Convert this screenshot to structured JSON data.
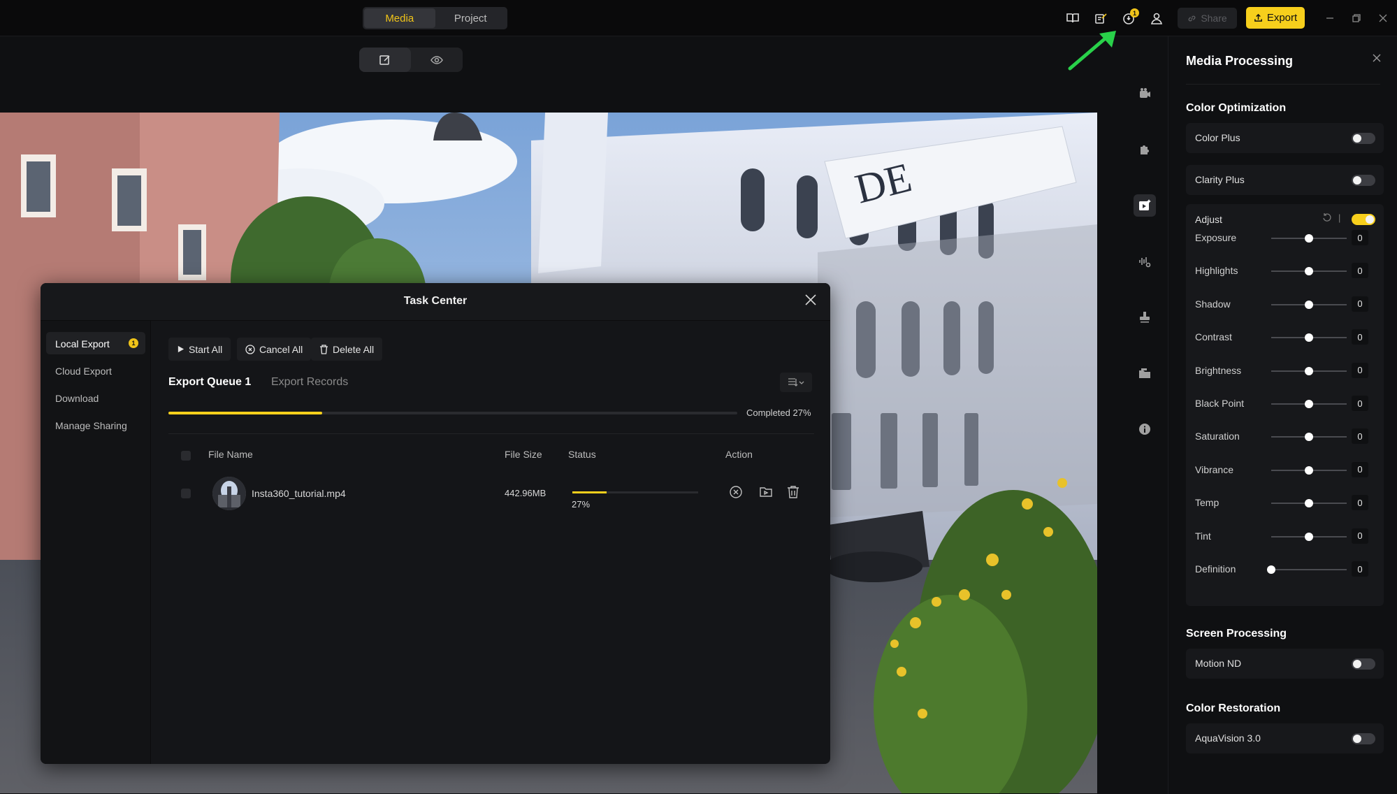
{
  "topbar": {
    "tabs": [
      {
        "label": "Media",
        "active": true
      },
      {
        "label": "Project",
        "active": false
      }
    ],
    "icons": [
      "book-icon",
      "edit-notes-icon",
      "task-center-icon",
      "user-icon"
    ],
    "task_badge": "1",
    "share_label": "Share",
    "export_label": "Export",
    "window_controls": [
      "minimize-icon",
      "restore-icon",
      "close-icon"
    ]
  },
  "view_toggle": [
    "edit-icon",
    "preview-eye-icon"
  ],
  "task_center": {
    "title": "Task Center",
    "sidebar": [
      {
        "label": "Local Export",
        "badge": "1",
        "active": true
      },
      {
        "label": "Cloud Export"
      },
      {
        "label": "Download"
      },
      {
        "label": "Manage Sharing"
      }
    ],
    "buttons": {
      "start_all": "Start All",
      "cancel_all": "Cancel All",
      "delete_all": "Delete All"
    },
    "tabs": {
      "queue": "Export Queue 1",
      "records": "Export Records"
    },
    "overall_progress": 0.27,
    "completed_label": "Completed 27%",
    "columns": {
      "file_name": "File Name",
      "file_size": "File Size",
      "status": "Status",
      "action": "Action"
    },
    "rows": [
      {
        "file_name": "Insta360_tutorial.mp4",
        "file_size": "442.96MB",
        "progress": 0.27,
        "progress_label": "27%"
      }
    ]
  },
  "panel": {
    "title": "Media Processing",
    "sections": {
      "color_optimization": "Color Optimization",
      "screen_processing": "Screen Processing",
      "color_restoration": "Color Restoration"
    },
    "toggles": {
      "color_plus": {
        "label": "Color Plus",
        "on": false
      },
      "clarity_plus": {
        "label": "Clarity Plus",
        "on": false
      },
      "adjust": {
        "label": "Adjust",
        "on": true
      },
      "motion_nd": {
        "label": "Motion ND",
        "on": false
      },
      "aquavision": {
        "label": "AquaVision 3.0",
        "on": false
      }
    },
    "sliders": [
      {
        "name": "Exposure",
        "value": "0",
        "position": 0.5
      },
      {
        "name": "Highlights",
        "value": "0",
        "position": 0.5
      },
      {
        "name": "Shadow",
        "value": "0",
        "position": 0.5
      },
      {
        "name": "Contrast",
        "value": "0",
        "position": 0.5
      },
      {
        "name": "Brightness",
        "value": "0",
        "position": 0.5
      },
      {
        "name": "Black Point",
        "value": "0",
        "position": 0.5
      },
      {
        "name": "Saturation",
        "value": "0",
        "position": 0.5
      },
      {
        "name": "Vibrance",
        "value": "0",
        "position": 0.5
      },
      {
        "name": "Temp",
        "value": "0",
        "position": 0.5
      },
      {
        "name": "Tint",
        "value": "0",
        "position": 0.5
      },
      {
        "name": "Definition",
        "value": "0",
        "position": 0.0
      }
    ]
  },
  "rail_icons": [
    "camera-icon",
    "plugin-icon",
    "media-processing-icon",
    "audio-settings-icon",
    "stamp-icon",
    "folder-icon",
    "info-icon"
  ],
  "colors": {
    "accent": "#f7cf1c",
    "annotation_arrow": "#29d14a"
  }
}
